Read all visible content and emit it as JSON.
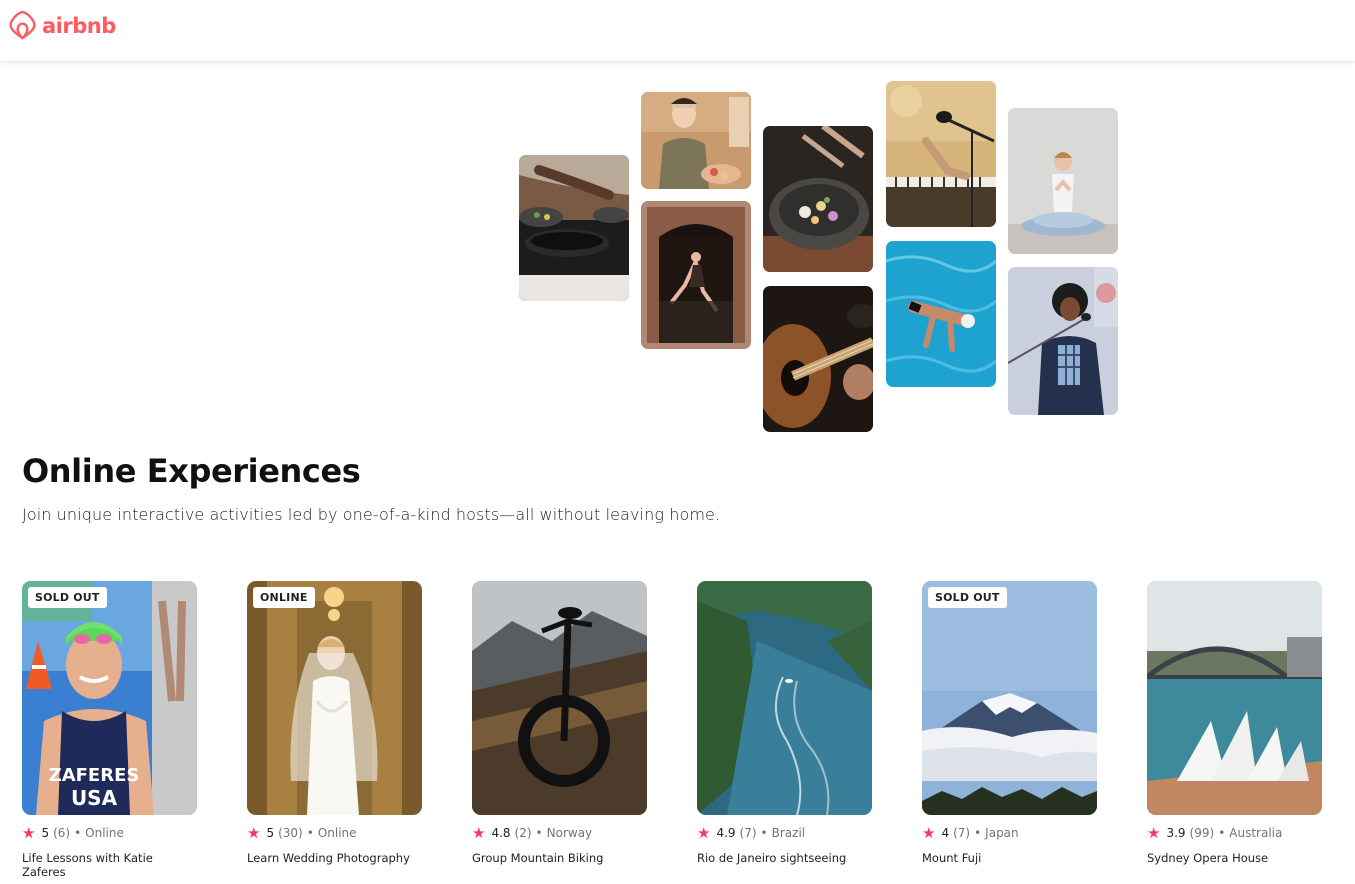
{
  "brand": {
    "name": "airbnb",
    "color": "#ff5a5f"
  },
  "hero": {
    "tiles": [
      {
        "label": "cooking class"
      },
      {
        "label": "pasta chef"
      },
      {
        "label": "flamenco dancer"
      },
      {
        "label": "plated dish"
      },
      {
        "label": "acoustic guitar"
      },
      {
        "label": "piano and microphone"
      },
      {
        "label": "swimmer in pool"
      },
      {
        "label": "yoga meditation"
      },
      {
        "label": "singer performing"
      }
    ]
  },
  "section": {
    "title": "Online Experiences",
    "subtitle": "Join unique interactive activities led by one-of-a-kind hosts—all without leaving home."
  },
  "accent_star": "#fe385c",
  "cards": [
    {
      "badge": "SOLD OUT",
      "rating": "5",
      "reviews": "(6)",
      "location": "Online",
      "title": "Life Lessons with Katie Zaferes"
    },
    {
      "badge": "ONLINE",
      "rating": "5",
      "reviews": "(30)",
      "location": "Online",
      "title": "Learn Wedding Photography"
    },
    {
      "badge": "",
      "rating": "4.8",
      "reviews": "(2)",
      "location": "Norway",
      "title": "Group Mountain Biking"
    },
    {
      "badge": "",
      "rating": "4.9",
      "reviews": "(7)",
      "location": "Brazil",
      "title": "Rio de Janeiro sightseeing"
    },
    {
      "badge": "SOLD OUT",
      "rating": "4",
      "reviews": "(7)",
      "location": "Japan",
      "title": "Mount Fuji"
    },
    {
      "badge": "",
      "rating": "3.9",
      "reviews": "(99)",
      "location": "Australia",
      "title": "Sydney Opera House"
    }
  ]
}
